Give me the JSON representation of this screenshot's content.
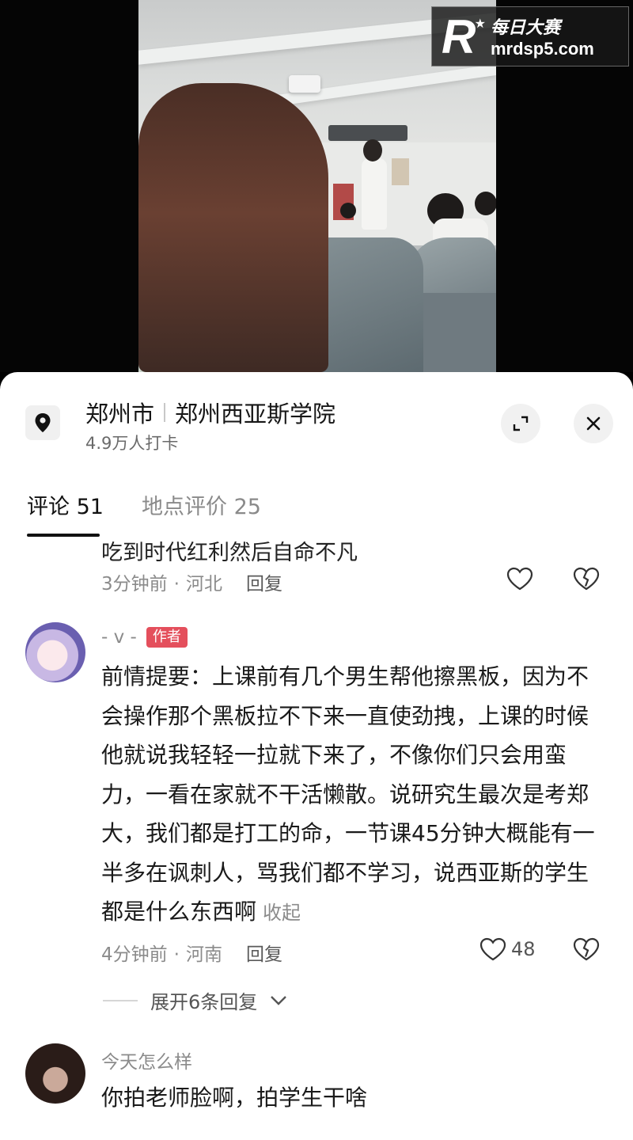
{
  "watermark": {
    "logo_letter": "R",
    "brand_cn": "每日大赛",
    "url": "mrdsp5.com"
  },
  "location": {
    "city": "郑州市",
    "place": "郑州西亚斯学院",
    "checkins": "4.9万人打卡"
  },
  "tabs": [
    {
      "label": "评论 51",
      "active": true
    },
    {
      "label": "地点评价 25",
      "active": false
    }
  ],
  "comments": [
    {
      "text_partial": "吃到时代红利然后自命不凡",
      "time": "3分钟前",
      "region": "河北",
      "reply_label": "回复",
      "likes": ""
    },
    {
      "username": "- v -",
      "badge": "作者",
      "text": "前情提要：上课前有几个男生帮他擦黑板，因为不会操作那个黑板拉不下来一直使劲拽，上课的时候他就说我轻轻一拉就下来了，不像你们只会用蛮力，一看在家就不干活懒散。说研究生最次是考郑大，我们都是打工的命，一节课45分钟大概能有一半多在讽刺人，骂我们都不学习，说西亚斯的学生都是什么东西啊",
      "collapse_label": "收起",
      "time": "4分钟前",
      "region": "河南",
      "reply_label": "回复",
      "likes": "48",
      "expand_replies": "展开6条回复"
    },
    {
      "username": "今天怎么样",
      "text": "你拍老师脸啊，拍学生干啥"
    }
  ],
  "icons": {
    "location": "location-pin-icon",
    "expand": "expand-icon",
    "close": "close-icon",
    "like": "heart-icon",
    "dislike": "broken-heart-icon",
    "chevron": "chevron-down-icon"
  },
  "colors": {
    "author_badge": "#e44f5c",
    "sheet_bg": "#ffffff",
    "video_bg": "#050505"
  }
}
